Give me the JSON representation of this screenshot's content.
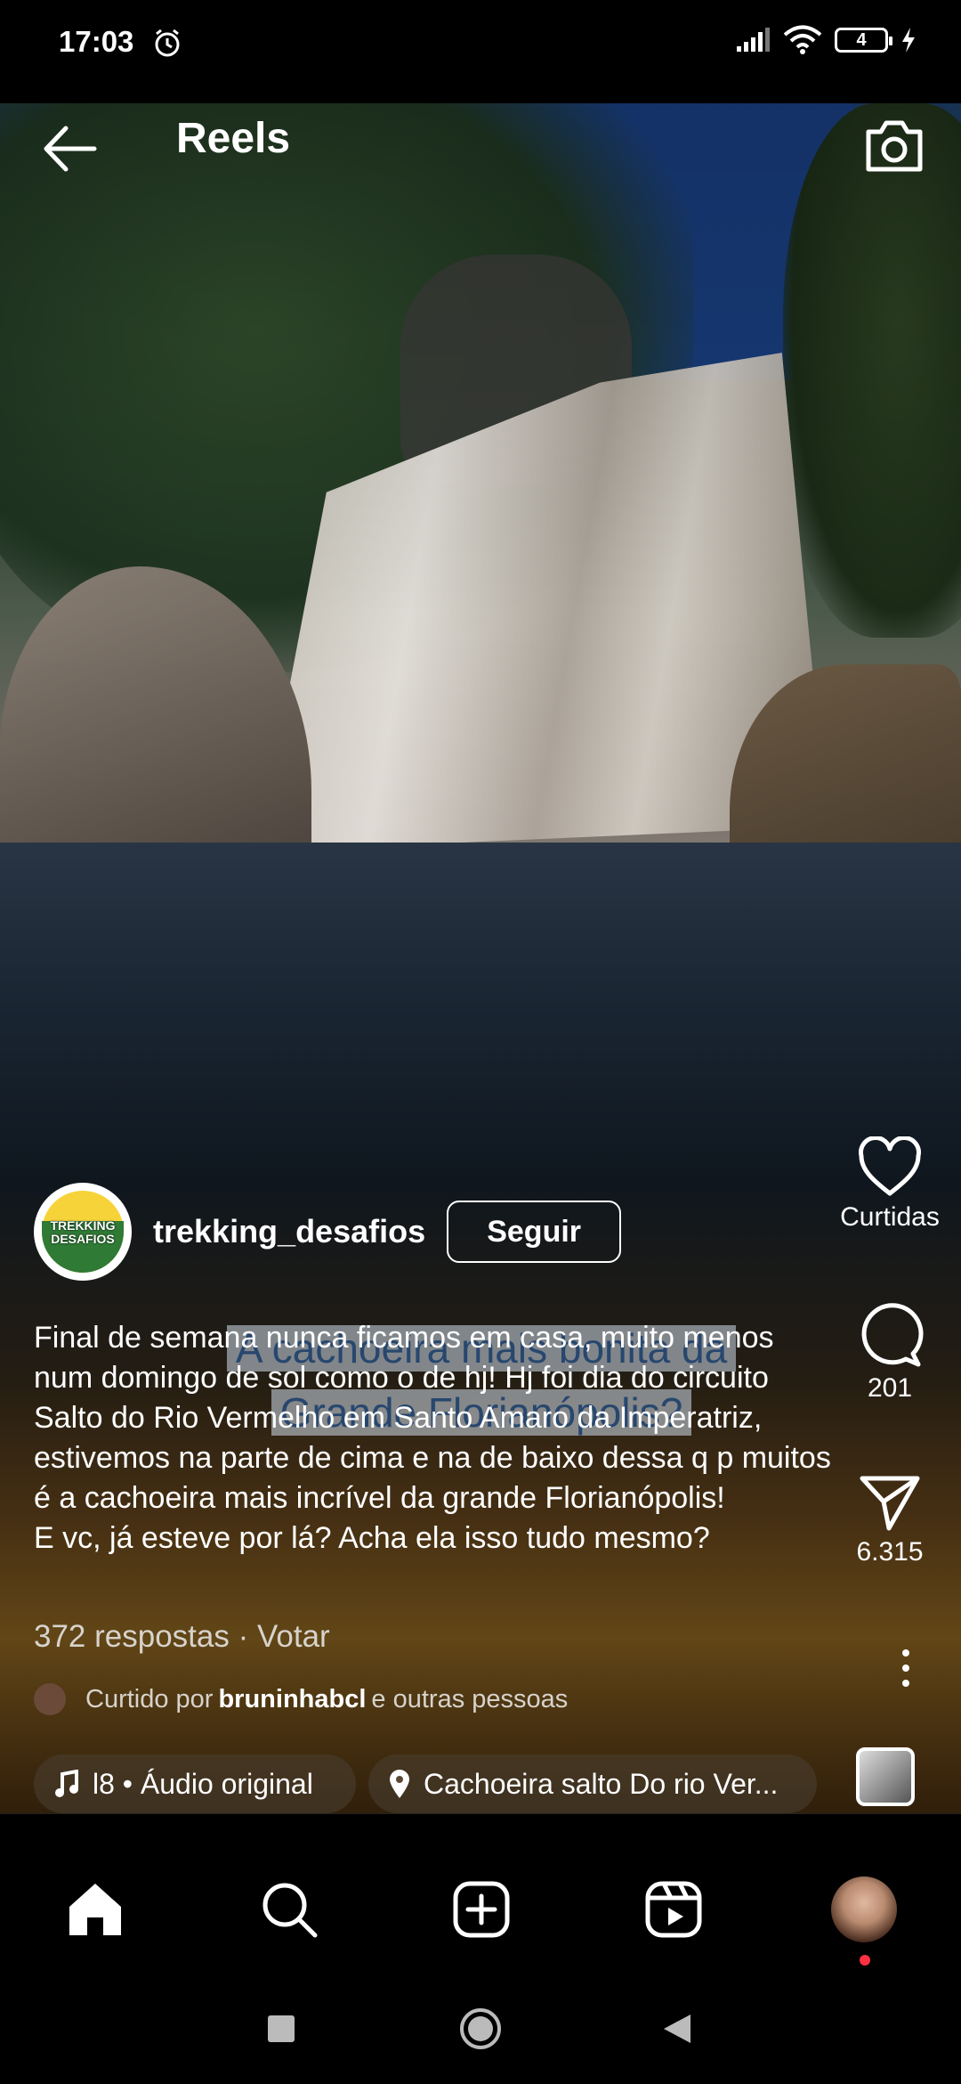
{
  "status_bar": {
    "time": "17:03",
    "battery": "4"
  },
  "header": {
    "title": "Reels"
  },
  "reel": {
    "overlay_text_line1": "A cachoeira mais bonita da",
    "overlay_text_line2": "Grande Florianópolis?",
    "username": "trekking_desafios",
    "avatar_text_line1": "TREKKING",
    "avatar_text_line2": "DESAFIOS",
    "follow_label": "Seguir",
    "caption_lines": [
      "Final de semana nunca ficamos em casa, muito menos num domingo de sol como o de hj! Hj foi dia do circuito Salto do Rio Vermelho em Santo Amaro da Imperatriz, estivemos na parte de cima e na de baixo dessa q p muitos é a cachoeira mais incrível da grande Florianópolis!",
      "E vc, já esteve por lá? Acha ela isso tudo mesmo?"
    ],
    "replies": "372 respostas · Votar",
    "liked_prefix": "Curtido por",
    "liked_user": "bruninhabcl",
    "liked_suffix": "e outras pessoas",
    "audio_label": "l8 • Áudio original",
    "location_label": "Cachoeira salto Do rio Ver..."
  },
  "actions": {
    "likes_label": "Curtidas",
    "comments_count": "201",
    "shares_count": "6.315"
  },
  "icons": {
    "back": "arrow-left-icon",
    "camera": "camera-icon",
    "like": "heart-icon",
    "comment": "comment-icon",
    "share": "send-icon",
    "more": "more-vertical-icon",
    "home": "home-icon",
    "search": "search-icon",
    "create": "plus-square-icon",
    "reels": "reels-icon"
  }
}
